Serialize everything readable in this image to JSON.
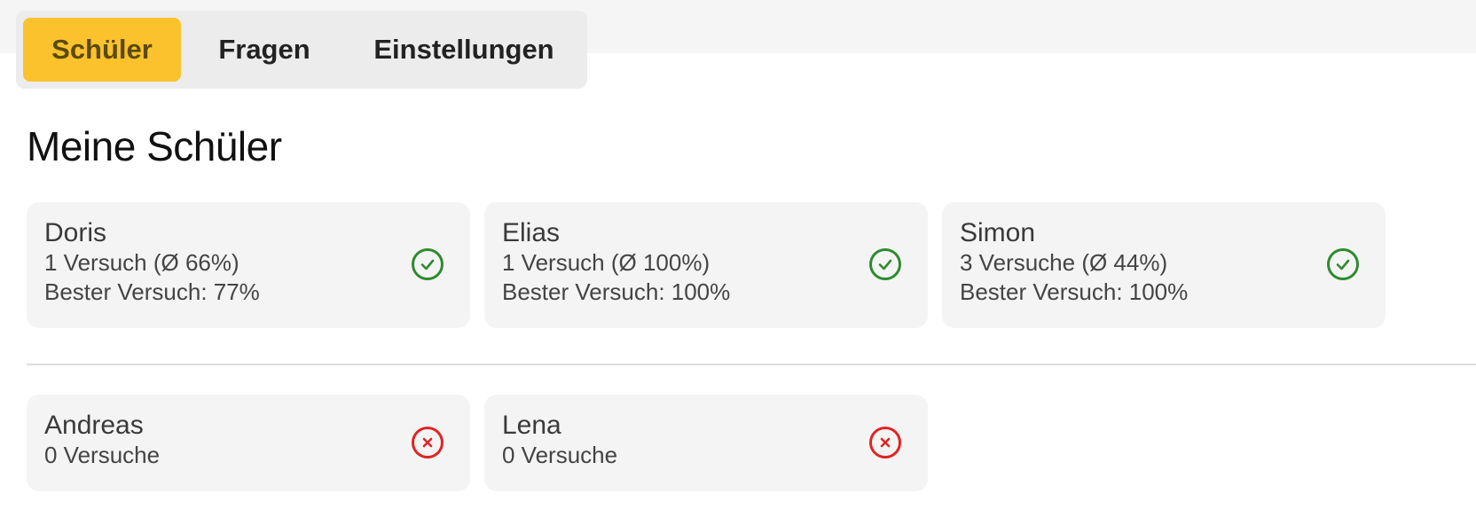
{
  "tabs": [
    {
      "label": "Schüler",
      "active": true
    },
    {
      "label": "Fragen",
      "active": false
    },
    {
      "label": "Einstellungen",
      "active": false
    }
  ],
  "page_title": "Meine Schüler",
  "colors": {
    "accent": "#fcc22d",
    "success": "#2e8b2e",
    "error": "#e02424",
    "card_bg": "#f4f4f4"
  },
  "students_done": [
    {
      "name": "Doris",
      "attempts": "1 Versuch (Ø 66%)",
      "best": "Bester Versuch: 77%",
      "status_icon": "check-circle-icon"
    },
    {
      "name": "Elias",
      "attempts": "1 Versuch (Ø 100%)",
      "best": "Bester Versuch: 100%",
      "status_icon": "check-circle-icon"
    },
    {
      "name": "Simon",
      "attempts": "3 Versuche (Ø 44%)",
      "best": "Bester Versuch: 100%",
      "status_icon": "check-circle-icon"
    }
  ],
  "students_open": [
    {
      "name": "Andreas",
      "attempts": "0 Versuche",
      "status_icon": "x-circle-icon"
    },
    {
      "name": "Lena",
      "attempts": "0 Versuche",
      "status_icon": "x-circle-icon"
    }
  ]
}
